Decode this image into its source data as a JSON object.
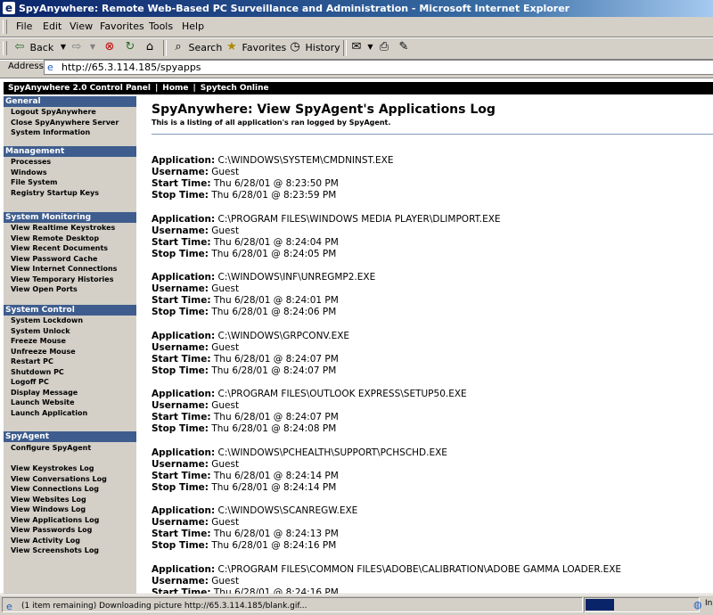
{
  "window": {
    "title": "SpyAnywhere: Remote Web-Based PC Surveillance and Administration - Microsoft Internet Explorer"
  },
  "menu": [
    "File",
    "Edit",
    "View",
    "Favorites",
    "Tools",
    "Help"
  ],
  "toolbar": {
    "back_label": "Back",
    "search_label": "Search",
    "favorites_label": "Favorites",
    "history_label": "History"
  },
  "address": {
    "label": "Address",
    "url": "http://65.3.114.185/spyapps"
  },
  "topnav": [
    "SpyAnywhere 2.0 Control Panel",
    "Home",
    "Spytech Online"
  ],
  "sidebar": {
    "sections": [
      {
        "title": "General",
        "items": [
          "Logout SpyAnywhere",
          "Close SpyAnywhere Server",
          "System Information"
        ]
      },
      {
        "title": "Management",
        "items": [
          "Processes",
          "Windows",
          "File System",
          "Registry Startup Keys"
        ]
      },
      {
        "title": "System Monitoring",
        "items": [
          "View Realtime Keystrokes",
          "View Remote Desktop",
          "View Recent Documents",
          "View Password Cache",
          "View Internet Connections",
          "View Temporary Histories",
          "View Open Ports"
        ]
      },
      {
        "title": "System Control",
        "items": [
          "System Lockdown",
          "System Unlock",
          "Freeze Mouse",
          "Unfreeze Mouse",
          "Restart PC",
          "Shutdown PC",
          "Logoff PC",
          "Display Message",
          "Launch Website",
          "Launch Application"
        ]
      },
      {
        "title": "SpyAgent",
        "items": [
          "Configure SpyAgent",
          "",
          "View Keystrokes Log",
          "View Conversations Log",
          "View Connections Log",
          "View Websites Log",
          "View Windows Log",
          "View Applications Log",
          "View Passwords Log",
          "View Activity Log",
          "View Screenshots Log"
        ]
      }
    ]
  },
  "page": {
    "title": "SpyAnywhere: View SpyAgent's Applications Log",
    "subtitle": "This is a listing of all application's ran logged by SpyAgent."
  },
  "labels": {
    "application": "Application:",
    "username": "Username:",
    "start": "Start Time:",
    "stop": "Stop Time:"
  },
  "entries": [
    {
      "application": "C:\\WINDOWS\\SYSTEM\\CMDNINST.EXE",
      "username": "Guest",
      "start": "Thu 6/28/01 @ 8:23:50 PM",
      "stop": "Thu 6/28/01 @ 8:23:59 PM"
    },
    {
      "application": "C:\\PROGRAM FILES\\WINDOWS MEDIA PLAYER\\DLIMPORT.EXE",
      "username": "Guest",
      "start": "Thu 6/28/01 @ 8:24:04 PM",
      "stop": "Thu 6/28/01 @ 8:24:05 PM"
    },
    {
      "application": "C:\\WINDOWS\\INF\\UNREGMP2.EXE",
      "username": "Guest",
      "start": "Thu 6/28/01 @ 8:24:01 PM",
      "stop": "Thu 6/28/01 @ 8:24:06 PM"
    },
    {
      "application": "C:\\WINDOWS\\GRPCONV.EXE",
      "username": "Guest",
      "start": "Thu 6/28/01 @ 8:24:07 PM",
      "stop": "Thu 6/28/01 @ 8:24:07 PM"
    },
    {
      "application": "C:\\PROGRAM FILES\\OUTLOOK EXPRESS\\SETUP50.EXE",
      "username": "Guest",
      "start": "Thu 6/28/01 @ 8:24:07 PM",
      "stop": "Thu 6/28/01 @ 8:24:08 PM"
    },
    {
      "application": "C:\\WINDOWS\\PCHEALTH\\SUPPORT\\PCHSCHD.EXE",
      "username": "Guest",
      "start": "Thu 6/28/01 @ 8:24:14 PM",
      "stop": "Thu 6/28/01 @ 8:24:14 PM"
    },
    {
      "application": "C:\\WINDOWS\\SCANREGW.EXE",
      "username": "Guest",
      "start": "Thu 6/28/01 @ 8:24:13 PM",
      "stop": "Thu 6/28/01 @ 8:24:16 PM"
    },
    {
      "application": "C:\\PROGRAM FILES\\COMMON FILES\\ADOBE\\CALIBRATION\\ADOBE GAMMA LOADER.EXE",
      "username": "Guest",
      "start": "Thu 6/28/01 @ 8:24:16 PM",
      "stop": ""
    }
  ],
  "status": {
    "text": "(1 item remaining) Downloading picture http://65.3.114.185/blank.gif...",
    "progress": 0.25,
    "zone": "In"
  }
}
